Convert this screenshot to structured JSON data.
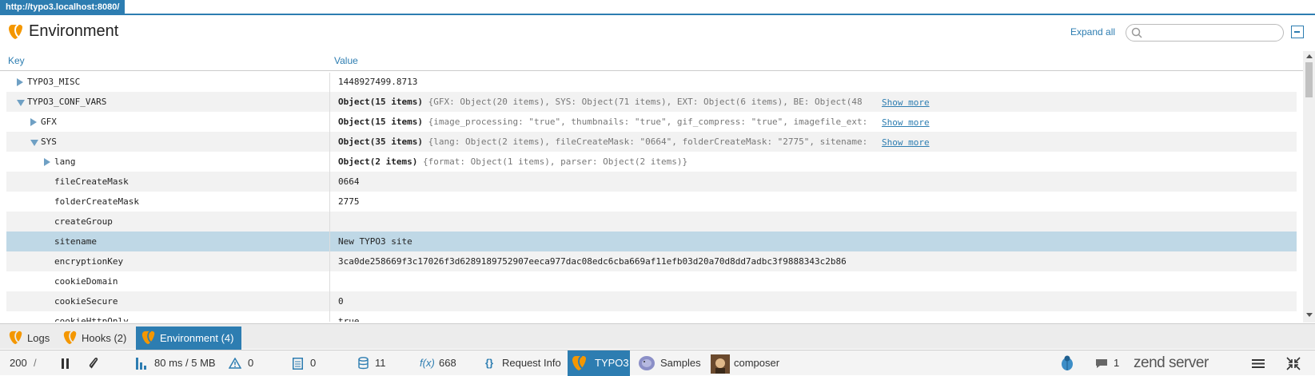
{
  "url": "http://typo3.localhost:8080/",
  "header": {
    "title": "Environment",
    "expand_all": "Expand all",
    "search_placeholder": ""
  },
  "columns": {
    "key": "Key",
    "value": "Value"
  },
  "rows": [
    {
      "key": "TYPO3_MISC",
      "indent": 0,
      "toggle": "collapsed",
      "value_plain": "1448927499.8713",
      "value_bold": "",
      "preview": "",
      "show_more": ""
    },
    {
      "key": "TYPO3_CONF_VARS",
      "indent": 0,
      "toggle": "expanded",
      "value_plain": "",
      "value_bold": "Object(15 items)",
      "preview": "{GFX: Object(20 items), SYS: Object(71 items), EXT: Object(6 items), BE: Object(48",
      "show_more": "Show more"
    },
    {
      "key": "GFX",
      "indent": 1,
      "toggle": "collapsed",
      "value_plain": "",
      "value_bold": "Object(15 items)",
      "preview": "{image_processing: \"true\", thumbnails: \"true\", gif_compress: \"true\", imagefile_ext:",
      "show_more": "Show more"
    },
    {
      "key": "SYS",
      "indent": 1,
      "toggle": "expanded",
      "value_plain": "",
      "value_bold": "Object(35 items)",
      "preview": "{lang: Object(2 items), fileCreateMask: \"0664\", folderCreateMask: \"2775\", sitename:",
      "show_more": "Show more"
    },
    {
      "key": "lang",
      "indent": 2,
      "toggle": "collapsed",
      "value_plain": "",
      "value_bold": "Object(2 items)",
      "preview": "{format: Object(1 items), parser: Object(2 items)}",
      "show_more": ""
    },
    {
      "key": "fileCreateMask",
      "indent": 2,
      "toggle": "none",
      "value_plain": "0664",
      "value_bold": "",
      "preview": "",
      "show_more": ""
    },
    {
      "key": "folderCreateMask",
      "indent": 2,
      "toggle": "none",
      "value_plain": "2775",
      "value_bold": "",
      "preview": "",
      "show_more": ""
    },
    {
      "key": "createGroup",
      "indent": 2,
      "toggle": "none",
      "value_plain": "",
      "value_bold": "",
      "preview": "",
      "show_more": ""
    },
    {
      "key": "sitename",
      "indent": 2,
      "toggle": "none",
      "value_plain": "New TYPO3 site",
      "value_bold": "",
      "preview": "",
      "show_more": "",
      "selected": true
    },
    {
      "key": "encryptionKey",
      "indent": 2,
      "toggle": "none",
      "value_plain": "3ca0de258669f3c17026f3d6289189752907eeca977dac08edc6cba669af11efb03d20a70d8dd7adbc3f9888343c2b86",
      "value_bold": "",
      "preview": "",
      "show_more": ""
    },
    {
      "key": "cookieDomain",
      "indent": 2,
      "toggle": "none",
      "value_plain": "",
      "value_bold": "",
      "preview": "",
      "show_more": ""
    },
    {
      "key": "cookieSecure",
      "indent": 2,
      "toggle": "none",
      "value_plain": "0",
      "value_bold": "",
      "preview": "",
      "show_more": ""
    },
    {
      "key": "cookieHttpOnly",
      "indent": 2,
      "toggle": "none",
      "value_plain": "true",
      "value_bold": "",
      "preview": "",
      "show_more": ""
    }
  ],
  "tabs": [
    {
      "label": "Logs",
      "active": false
    },
    {
      "label": "Hooks (2)",
      "active": false
    },
    {
      "label": "Environment (4)",
      "active": true
    }
  ],
  "toolbar": {
    "status": "200",
    "slash": "/",
    "timing": "80 ms / 5 MB",
    "warnings": "0",
    "logs": "0",
    "db": "11",
    "functions_icon": "f(x)",
    "functions": "668",
    "request_icon": "{}",
    "request": "Request Info",
    "typo3": "TYPO3",
    "samples": "Samples",
    "composer": "composer",
    "messages": "1",
    "brand": "zend server"
  },
  "colors": {
    "accent": "#2d7db1",
    "typo3_orange": "#f49700",
    "selected_row": "#bfd8e6"
  }
}
